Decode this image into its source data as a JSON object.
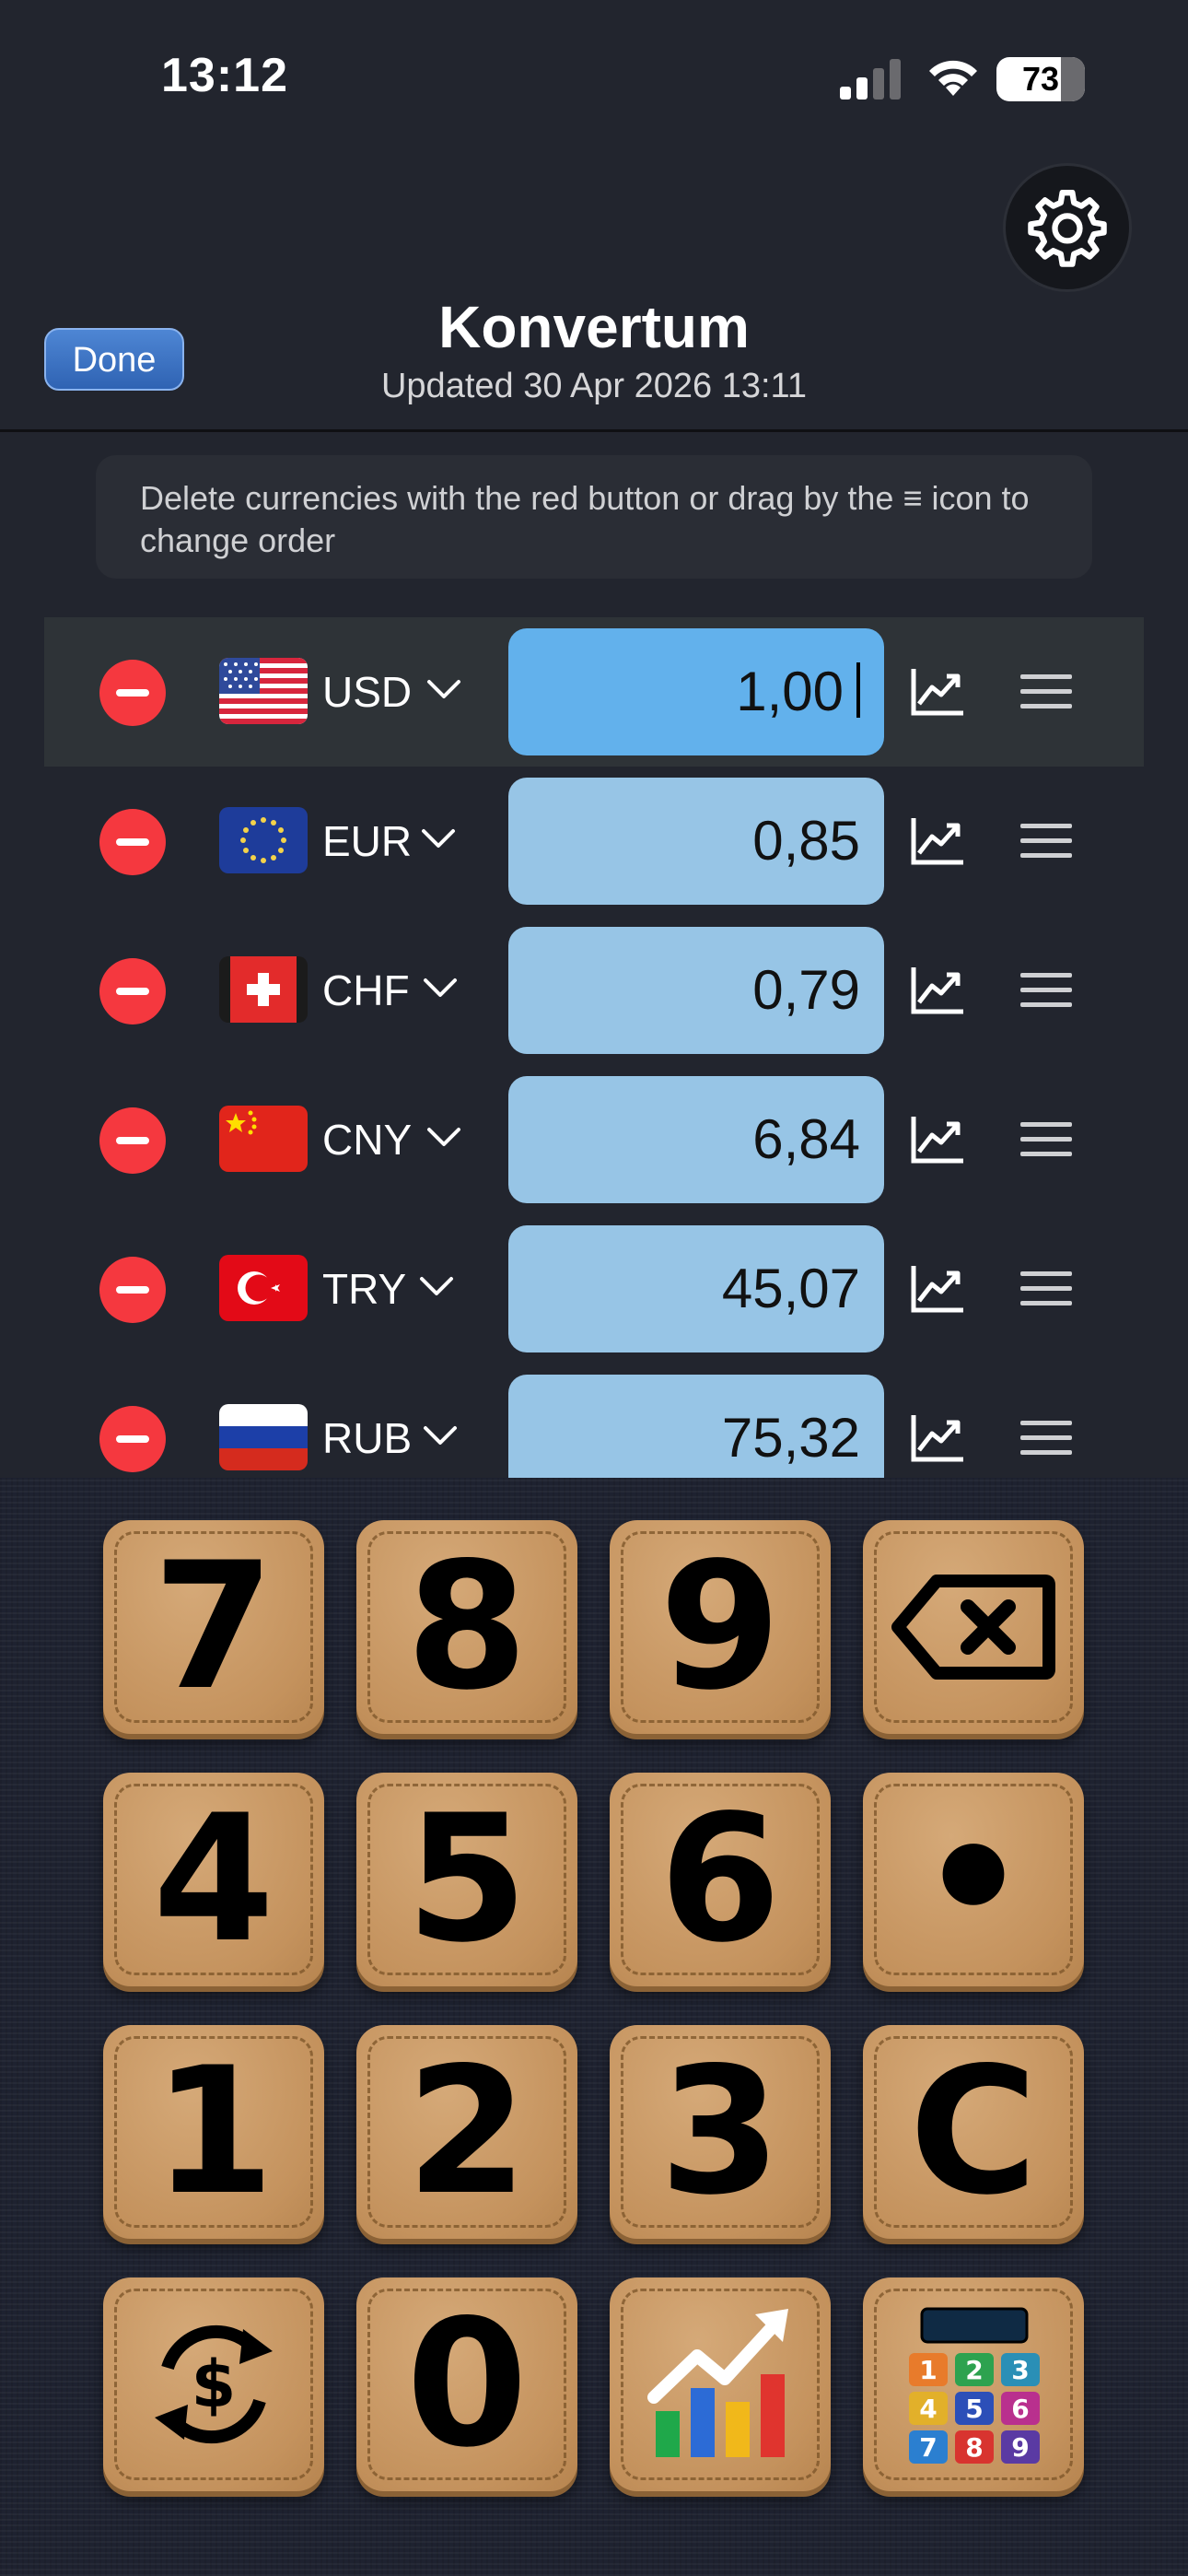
{
  "status_bar": {
    "time": "13:12",
    "battery": "73"
  },
  "header": {
    "done_label": "Done",
    "title": "Konvertum",
    "updated": "Updated 30 Apr 2026 13:11",
    "settings_icon": "gear-icon"
  },
  "info_text": "Delete currencies with the red button or drag by the ≡ icon to change order",
  "currencies": [
    {
      "code": "USD",
      "flag": "us-flag",
      "amount": "1,00",
      "active": true
    },
    {
      "code": "EUR",
      "flag": "eu-flag",
      "amount": "0,85",
      "active": false
    },
    {
      "code": "CHF",
      "flag": "ch-flag",
      "amount": "0,79",
      "active": false
    },
    {
      "code": "CNY",
      "flag": "cn-flag",
      "amount": "6,84",
      "active": false
    },
    {
      "code": "TRY",
      "flag": "tr-flag",
      "amount": "45,07",
      "active": false
    },
    {
      "code": "RUB",
      "flag": "ru-flag",
      "amount": "75,32",
      "active": false
    }
  ],
  "keypad": {
    "keys": [
      "7",
      "8",
      "9",
      "backspace-icon",
      "4",
      "5",
      "6",
      "•",
      "1",
      "2",
      "3",
      "C",
      "currency-exchange-icon",
      "0",
      "bar-chart-icon",
      "calculator-icon"
    ]
  },
  "colors": {
    "accent_blue": "#62b1ec",
    "field_blue": "#97c5e6",
    "delete_red": "#f5383f",
    "key_leather": "#c89967"
  }
}
